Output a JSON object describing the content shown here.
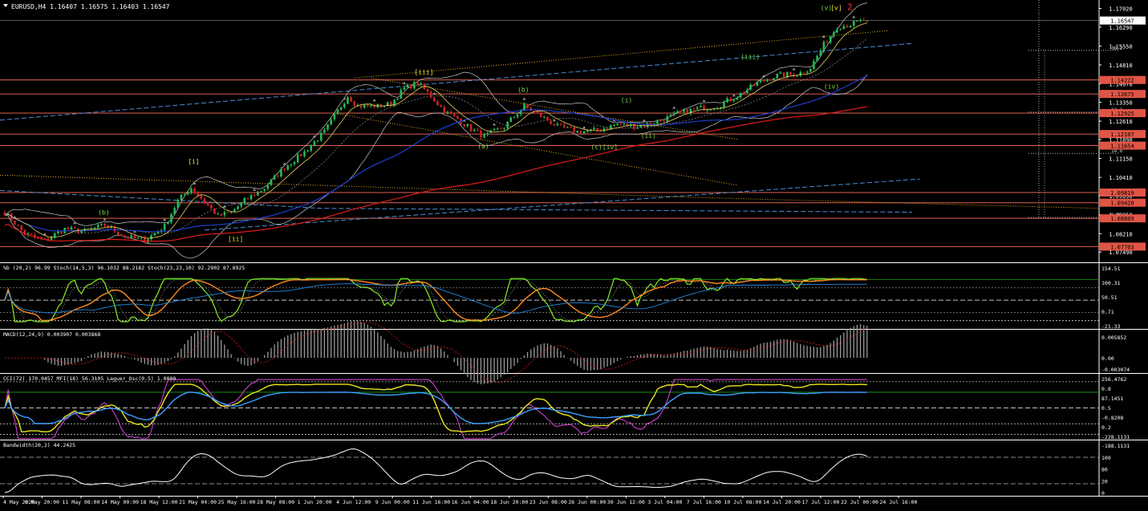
{
  "colors": {
    "background": "#000000",
    "grid": "#ffffff",
    "bull_candle": "#22bb55",
    "bear_candle": "#cc2222",
    "hline": "#e06050",
    "price_label_bg": "#e05545",
    "current_price_bg": "#ffffff",
    "ma_long": "#e01b1b",
    "ma_mid": "#1e3fcf",
    "bollinger": "#c8c8c8",
    "trend_dashed": "#4a8fd8",
    "fib_dotted": "#e8b020",
    "wave_label_green": "#7cd44a",
    "wave_label_yellow": "#e8e030",
    "wave_label_red": "#ff3030",
    "stoch_fast": "#88ee22",
    "stoch_slow": "#ff8c1a",
    "stoch_blue": "#2288dd",
    "macd_hist": "#9a9a9a",
    "macd_signal": "#e02020",
    "cci": "#e8e820",
    "mfi": "#3aa0ff",
    "laguerre": "#d040d0",
    "bandwidth": "#ffffff",
    "level_green": "#19a019"
  },
  "header": {
    "symbol_line": "EURUSD,H4  1.16407 1.16575 1.16403 1.16547"
  },
  "price_scale": {
    "labels": [
      "1.17020",
      "1.16290",
      "1.15550",
      "1.14810",
      "1.14070",
      "1.13350",
      "1.12610",
      "1.11890",
      "1.11150",
      "1.10410",
      "1.09690",
      "1.08950",
      "1.08210",
      "1.07490"
    ],
    "boxed": [
      "1.14222",
      "1.13675",
      "1.12925",
      "1.12107",
      "1.11654",
      "1.09819",
      "1.09420",
      "1.08809",
      "1.07703"
    ],
    "current": "1.16547"
  },
  "fib_levels": [
    {
      "label": "38.2",
      "value": 1.1538
    },
    {
      "label": "23.6",
      "value": 1.1296
    },
    {
      "label": "14.6",
      "value": 1.1135
    },
    {
      "label": "0.0",
      "value": 1.0884
    }
  ],
  "wave_labels": [
    {
      "text": "[i]",
      "i": 55,
      "price": 1.1095,
      "color": "yellow"
    },
    {
      "text": "[ii]",
      "i": 67,
      "price": 1.0792,
      "color": "yellow"
    },
    {
      "text": "[iii]",
      "i": 123,
      "price": 1.1445,
      "color": "yellow"
    },
    {
      "text": "(b)",
      "i": 28,
      "price": 1.0895,
      "color": "green"
    },
    {
      "text": "(b)",
      "i": 154,
      "price": 1.1375,
      "color": "green"
    },
    {
      "text": "(a)",
      "i": 142,
      "price": 1.1155,
      "color": "green"
    },
    {
      "text": "(c)[iv]",
      "i": 176,
      "price": 1.1152,
      "color": "green"
    },
    {
      "text": "(i)",
      "i": 185,
      "price": 1.1335,
      "color": "green"
    },
    {
      "text": "(ii)",
      "i": 191,
      "price": 1.1195,
      "color": "green"
    },
    {
      "text": "(iii)",
      "i": 221,
      "price": 1.1505,
      "color": "green"
    },
    {
      "text": "(iv)",
      "i": 246,
      "price": 1.1388,
      "color": "green"
    },
    {
      "text": "(v)",
      "i": 245,
      "price": 1.1696,
      "color": "green"
    },
    {
      "text": "[v]",
      "i": 248,
      "price": 1.1696,
      "color": "yellow"
    },
    {
      "text": "2",
      "i": 253,
      "price": 1.1696,
      "color": "red"
    }
  ],
  "stoch_panel": {
    "title": "%b (20,2) 96.99  Stoch(14,5,3) 96.1032 88.2182  Stoch(23,23,10) 92.2902 87.8925",
    "scale": [
      "154.51",
      "100.31",
      "50.51",
      "0.71",
      "-21.33"
    ]
  },
  "macd_panel": {
    "title": "MACD(12,24,9) 0.003907 0.003868",
    "scale": [
      "0.005852",
      "0.00",
      "-0.003074"
    ]
  },
  "cci_panel": {
    "title": "CCI(72) 170.0457  MFI(18) 56.3105  Laguer_Osc(0.5) 1.0000",
    "scale": [
      "256.4762",
      "0.8",
      "87.1451",
      "0.5",
      "-0.8208",
      "0.2",
      "-228.1131"
    ]
  },
  "bandwidth_panel": {
    "title": "Bandwidth(20,2) 44.2425",
    "scale": [
      "-188.1131",
      "100",
      "80",
      "20",
      "0"
    ]
  },
  "time_axis": [
    "4 May 2020",
    "6 May 20:00",
    "11 May 08:00",
    "14 May 00:00",
    "18 May 12:00",
    "21 May 04:00",
    "25 May 16:00",
    "28 May 08:00",
    "1 Jun 20:00",
    "4 Jun 12:00",
    "9 Jun 00:00",
    "11 Jun 16:00",
    "16 Jun 04:00",
    "18 Jun 20:00",
    "23 Jun 08:00",
    "26 Jun 00:00",
    "30 Jun 12:00",
    "3 Jul 04:00",
    "7 Jul 16:00",
    "10 Jul 08:00",
    "14 Jul 20:00",
    "17 Jul 12:00",
    "22 Jul 00:00",
    "24 Jul 16:00"
  ],
  "chart_data": {
    "type": "candlestick",
    "symbol": "EURUSD",
    "timeframe": "H4",
    "ohlc_last": {
      "open": 1.16407,
      "high": 1.16575,
      "low": 1.16403,
      "close": 1.16547
    },
    "ylim": [
      1.0712,
      1.1735
    ],
    "horizontal_levels": [
      1.14222,
      1.13675,
      1.12925,
      1.12107,
      1.11654,
      1.09819,
      1.0942,
      1.08809,
      1.07703
    ],
    "close_anchors": [
      [
        0,
        1.0905
      ],
      [
        6,
        1.082
      ],
      [
        12,
        1.0795
      ],
      [
        18,
        1.084
      ],
      [
        24,
        1.083
      ],
      [
        30,
        1.0855
      ],
      [
        36,
        1.081
      ],
      [
        42,
        1.0795
      ],
      [
        48,
        1.085
      ],
      [
        52,
        1.095
      ],
      [
        56,
        1.1
      ],
      [
        60,
        1.0945
      ],
      [
        64,
        1.089
      ],
      [
        68,
        1.0905
      ],
      [
        72,
        1.095
      ],
      [
        78,
        1.1
      ],
      [
        84,
        1.108
      ],
      [
        90,
        1.114
      ],
      [
        96,
        1.122
      ],
      [
        100,
        1.13
      ],
      [
        103,
        1.136
      ],
      [
        106,
        1.132
      ],
      [
        112,
        1.132
      ],
      [
        116,
        1.133
      ],
      [
        120,
        1.139
      ],
      [
        124,
        1.141
      ],
      [
        128,
        1.136
      ],
      [
        132,
        1.13
      ],
      [
        136,
        1.127
      ],
      [
        140,
        1.123
      ],
      [
        144,
        1.12
      ],
      [
        150,
        1.124
      ],
      [
        156,
        1.132
      ],
      [
        160,
        1.129
      ],
      [
        166,
        1.124
      ],
      [
        172,
        1.122
      ],
      [
        178,
        1.1225
      ],
      [
        184,
        1.125
      ],
      [
        190,
        1.124
      ],
      [
        196,
        1.126
      ],
      [
        202,
        1.129
      ],
      [
        208,
        1.131
      ],
      [
        214,
        1.132
      ],
      [
        220,
        1.136
      ],
      [
        226,
        1.141
      ],
      [
        232,
        1.144
      ],
      [
        238,
        1.1445
      ],
      [
        242,
        1.147
      ],
      [
        246,
        1.156
      ],
      [
        250,
        1.163
      ],
      [
        254,
        1.164
      ],
      [
        258,
        1.1655
      ]
    ]
  }
}
